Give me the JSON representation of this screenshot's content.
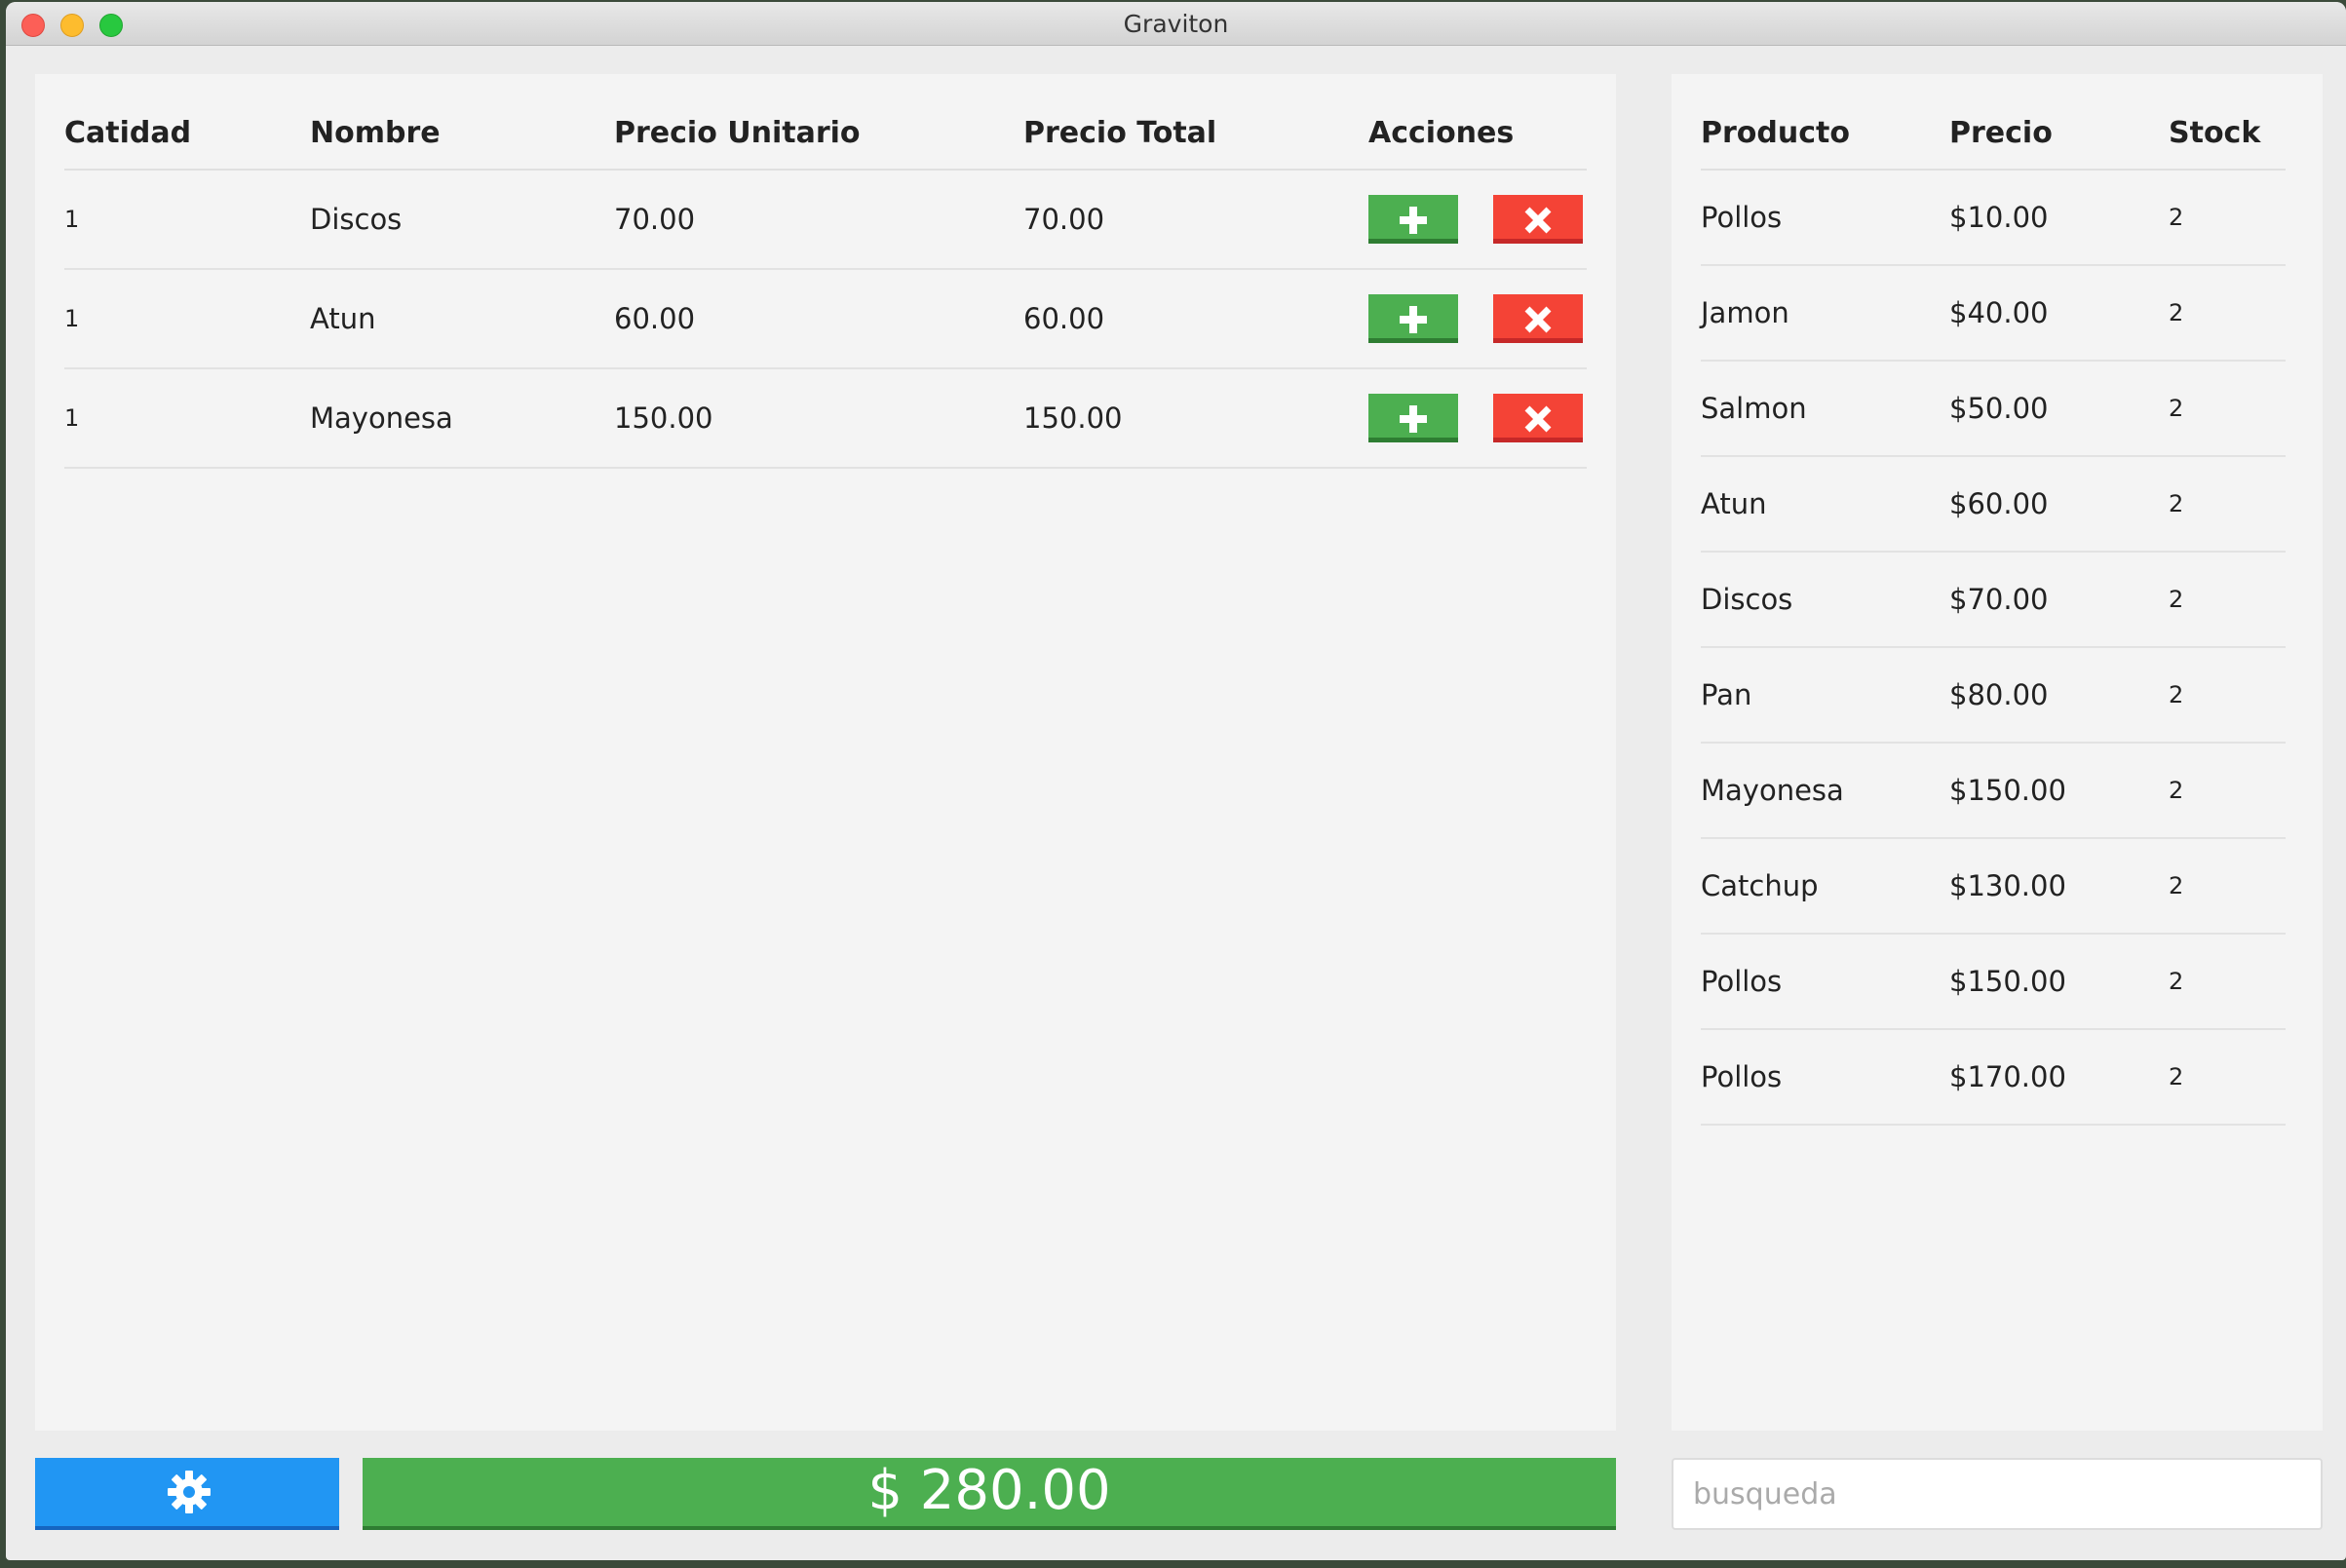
{
  "window": {
    "title": "Graviton"
  },
  "cart": {
    "headers": {
      "qty": "Catidad",
      "name": "Nombre",
      "unit_price": "Precio Unitario",
      "total_price": "Precio Total",
      "actions": "Acciones"
    },
    "rows": [
      {
        "qty": "1",
        "name": "Discos",
        "unit_price": "70.00",
        "total_price": "70.00"
      },
      {
        "qty": "1",
        "name": "Atun",
        "unit_price": "60.00",
        "total_price": "60.00"
      },
      {
        "qty": "1",
        "name": "Mayonesa",
        "unit_price": "150.00",
        "total_price": "150.00"
      }
    ]
  },
  "catalog": {
    "headers": {
      "product": "Producto",
      "price": "Precio",
      "stock": "Stock"
    },
    "rows": [
      {
        "product": "Pollos",
        "price": "$10.00",
        "stock": "2"
      },
      {
        "product": "Jamon",
        "price": "$40.00",
        "stock": "2"
      },
      {
        "product": "Salmon",
        "price": "$50.00",
        "stock": "2"
      },
      {
        "product": "Atun",
        "price": "$60.00",
        "stock": "2"
      },
      {
        "product": "Discos",
        "price": "$70.00",
        "stock": "2"
      },
      {
        "product": "Pan",
        "price": "$80.00",
        "stock": "2"
      },
      {
        "product": "Mayonesa",
        "price": "$150.00",
        "stock": "2"
      },
      {
        "product": "Catchup",
        "price": "$130.00",
        "stock": "2"
      },
      {
        "product": "Pollos",
        "price": "$150.00",
        "stock": "2"
      },
      {
        "product": "Pollos",
        "price": "$170.00",
        "stock": "2"
      }
    ]
  },
  "footer": {
    "total": "$ 280.00",
    "search_placeholder": "busqueda",
    "settings_icon": "gear-icon"
  },
  "colors": {
    "add": "#4caf50",
    "delete": "#f44336",
    "settings": "#2196f3",
    "total": "#4caf50"
  }
}
